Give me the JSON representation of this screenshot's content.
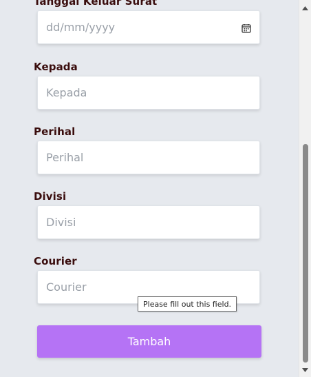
{
  "form": {
    "tanggal_keluar": {
      "label": "Tanggal Keluar Surat",
      "placeholder": "dd/mm/yyyy"
    },
    "kepada": {
      "label": "Kepada",
      "placeholder": "Kepada"
    },
    "perihal": {
      "label": "Perihal",
      "placeholder": "Perihal"
    },
    "divisi": {
      "label": "Divisi",
      "placeholder": "Divisi"
    },
    "courier": {
      "label": "Courier",
      "placeholder": "Courier"
    },
    "submit_label": "Tambah"
  },
  "tooltip": {
    "text": "Please fill out this field."
  },
  "icons": {
    "date_picker": "calendar-icon",
    "scroll_up": "caret-up-icon",
    "scroll_down": "caret-down-icon"
  },
  "colors": {
    "button": "#b573f5",
    "label": "#3a0d0d",
    "background": "#e6e9ee"
  }
}
